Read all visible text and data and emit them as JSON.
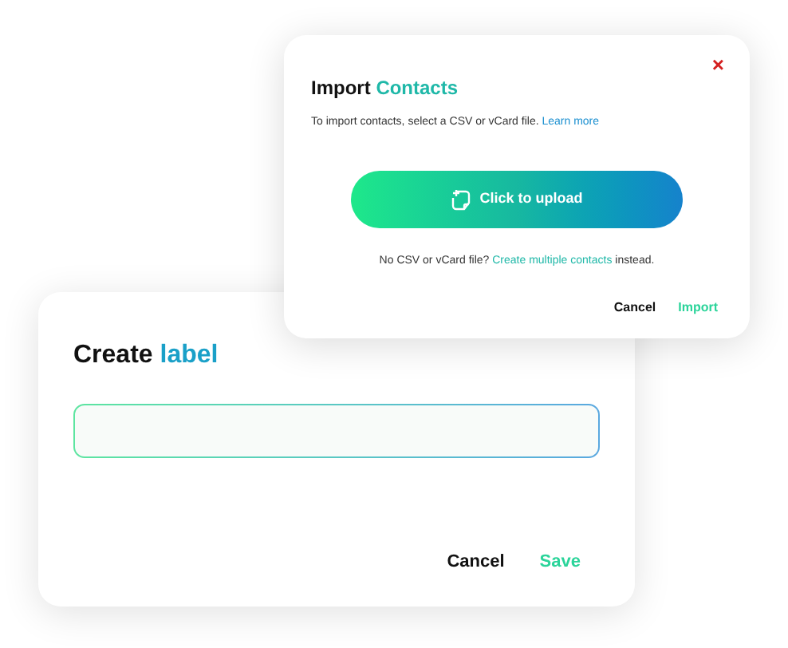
{
  "import_dialog": {
    "title": "Import",
    "title_accent": "Contacts",
    "close": "×",
    "description": "To import contacts, select a CSV or vCard file.",
    "description_link": "Learn more",
    "upload_button": "Click to upload",
    "hint": "No CSV or vCard file?",
    "hint_link": "Create multiple contacts",
    "hint_end": "instead.",
    "buttons": [
      {
        "label": "Cancel",
        "kind": "secondary"
      },
      {
        "label": "Import",
        "kind": "primary"
      }
    ]
  },
  "label_dialog": {
    "title": "Create",
    "title_accent": "label",
    "field": {
      "focused": true
    },
    "buttons": [
      {
        "label": "Cancel",
        "kind": "secondary"
      },
      {
        "label": "Save",
        "kind": "primary"
      }
    ]
  }
}
